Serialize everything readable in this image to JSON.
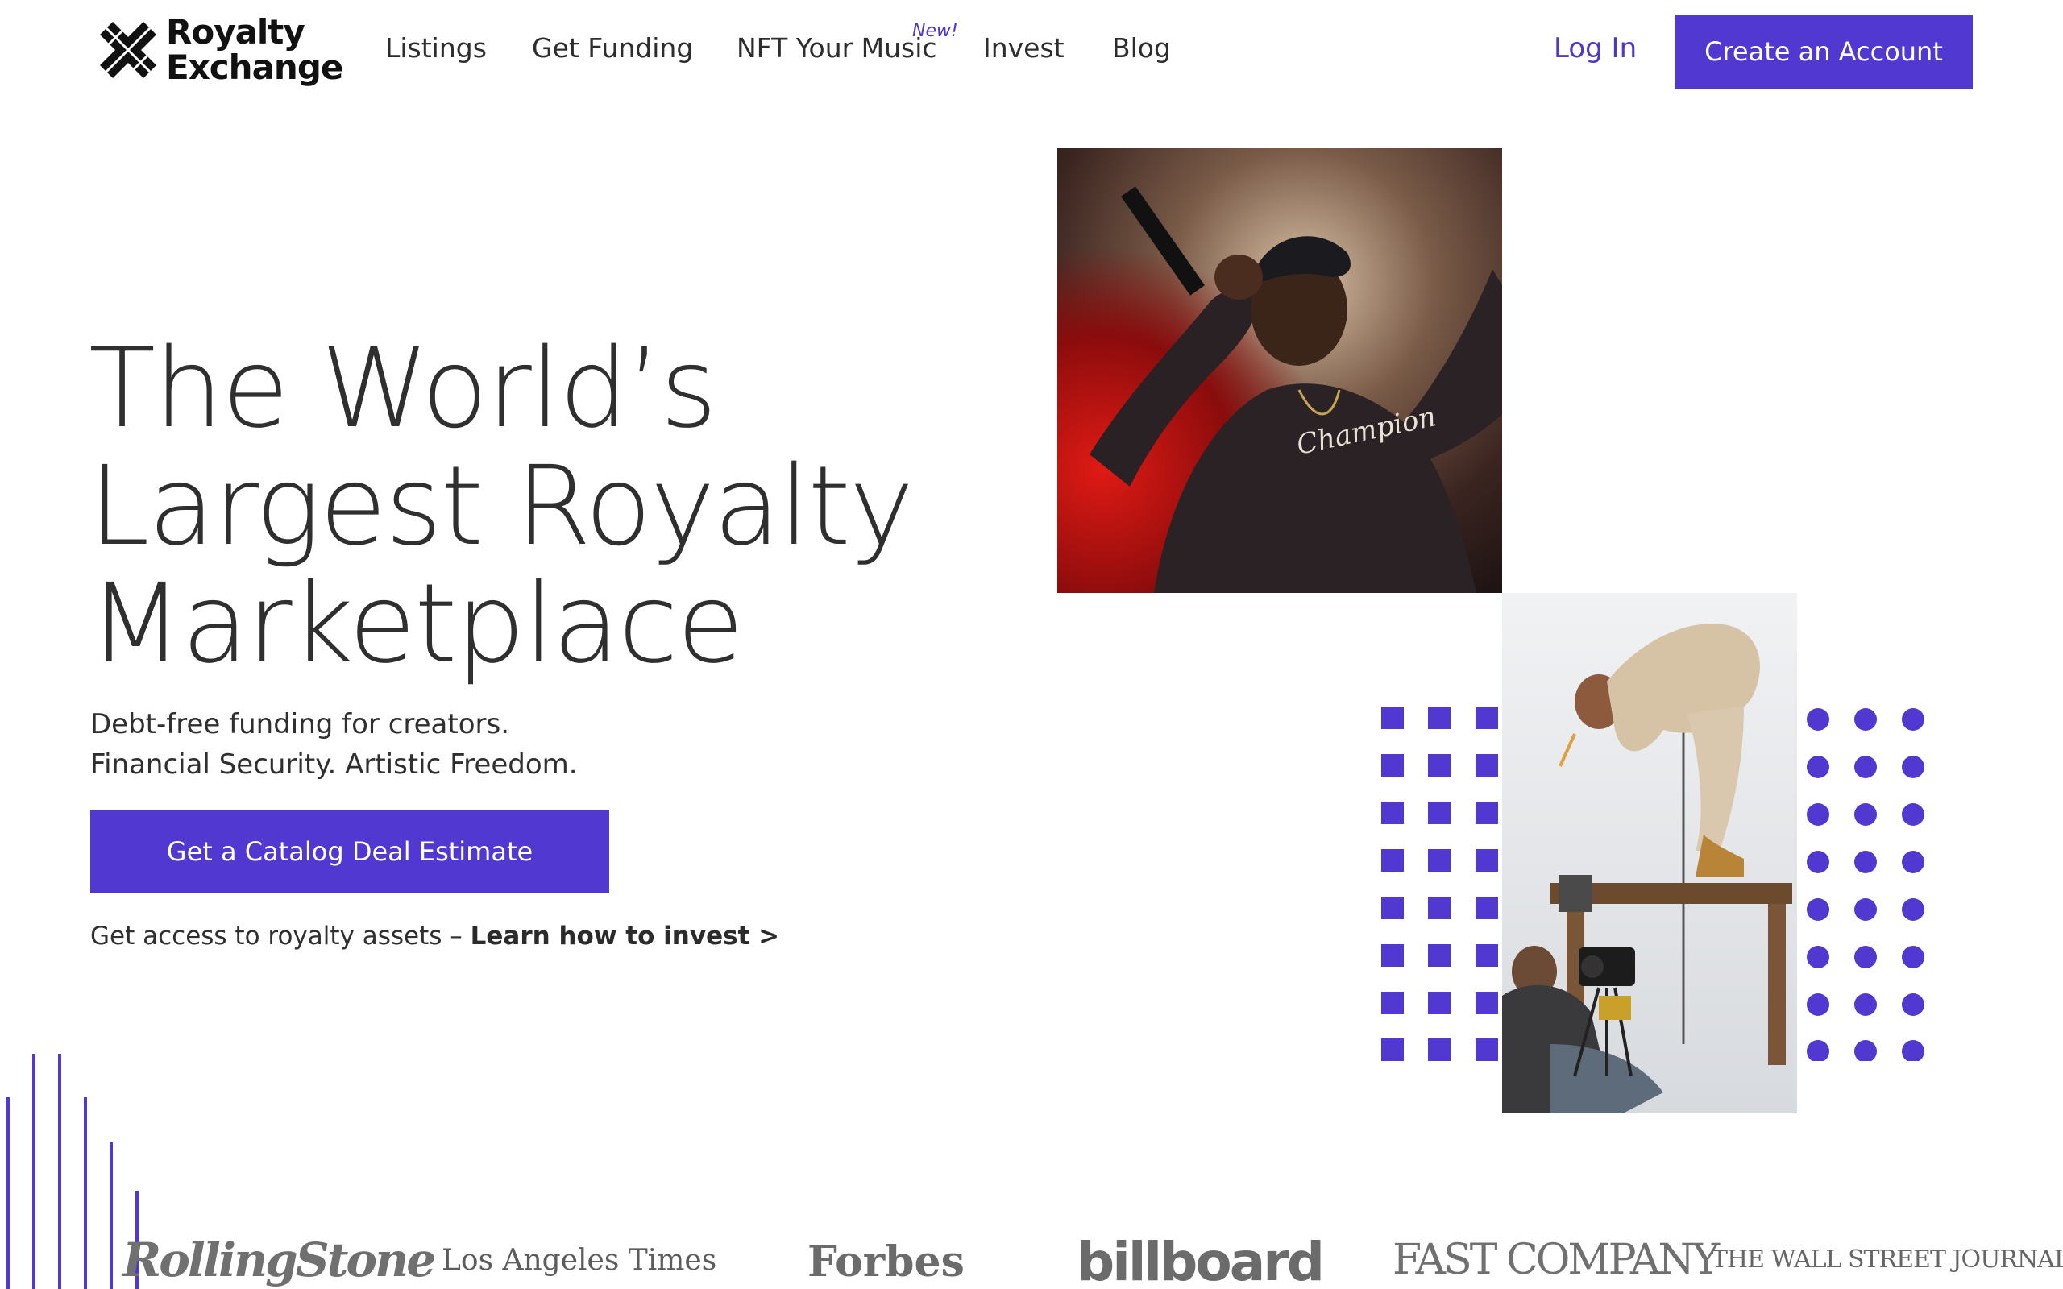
{
  "brand": {
    "line1": "Royalty",
    "line2": "Exchange",
    "accent_color": "#5038d0"
  },
  "nav": {
    "items": [
      {
        "label": "Listings"
      },
      {
        "label": "Get Funding"
      },
      {
        "label": "NFT Your Music",
        "badge": "New!"
      },
      {
        "label": "Invest"
      },
      {
        "label": "Blog"
      }
    ],
    "login": "Log In",
    "create_account": "Create an Account"
  },
  "hero": {
    "title_lines": [
      "The World’s",
      "Largest Royalty",
      "Marketplace"
    ],
    "subtitle_lines": [
      "Debt-free funding for creators.",
      "Financial Security. Artistic Freedom."
    ],
    "cta": "Get a Catalog Deal Estimate",
    "invest_prefix": "Get access to royalty assets – ",
    "invest_link": "Learn how to invest >"
  },
  "images": {
    "photo1": "performer-with-microphone-photo",
    "photo2": "artist-on-table-photoshoot-photo"
  },
  "press": {
    "logos": [
      "RollingStone",
      "Los Angeles Times",
      "Forbes",
      "billboard",
      "FAST COMPANY",
      "THE WALL STREET JOURNAL."
    ]
  }
}
